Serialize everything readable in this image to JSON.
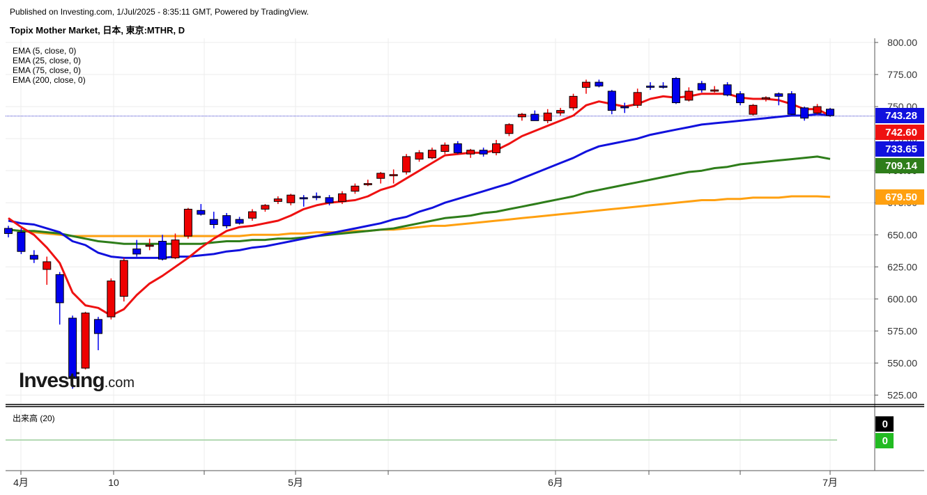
{
  "header": {
    "published": "Published on Investing.com, 1/Jul/2025 - 8:35:11 GMT, Powered by TradingView.",
    "title": "Topix Mother Market, 日本, 東京:MTHR, D"
  },
  "legend": {
    "ema5": "EMA (5, close, 0)",
    "ema25": "EMA (25, close, 0)",
    "ema75": "EMA (75, close, 0)",
    "ema200": "EMA (200, close, 0)"
  },
  "volume_label": "出来高 (20)",
  "logo": {
    "brand": "Investing",
    "suffix": ".com"
  },
  "colors": {
    "up": "#ee0000",
    "down": "#0000ee",
    "ema5": "#ee1111",
    "ema25": "#1111dd",
    "ema75": "#2e7d1a",
    "ema200": "#ffa010",
    "grid": "#ececec"
  },
  "chart_data": {
    "type": "candlestick",
    "ylim": [
      520,
      800
    ],
    "y_ticks": [
      "800.00",
      "775.00",
      "750.00",
      "725.00",
      "700.00",
      "675.00",
      "650.00",
      "625.00",
      "600.00",
      "575.00",
      "550.00",
      "525.00"
    ],
    "x_tick_labels": [
      "4月",
      "10",
      "5月",
      "6月",
      "7月"
    ],
    "last_price": 742.6,
    "price_tags": [
      {
        "label": "743.28",
        "value": 743.28,
        "color": "#1111dd"
      },
      {
        "label": "742.60",
        "value": 742.6,
        "color": "#ee1111"
      },
      {
        "label": "733.65",
        "value": 733.65,
        "color": "#1111dd"
      },
      {
        "label": "709.14",
        "value": 709.14,
        "color": "#2e7d1a"
      },
      {
        "label": "679.50",
        "value": 679.5,
        "color": "#ffa010"
      }
    ],
    "volume_tags": [
      {
        "label": "0",
        "color": "#000000"
      },
      {
        "label": "0",
        "color": "#22bb22"
      }
    ],
    "candles": [
      {
        "o": 655,
        "h": 657,
        "l": 648,
        "c": 651
      },
      {
        "o": 652,
        "h": 655,
        "l": 635,
        "c": 637
      },
      {
        "o": 634,
        "h": 638,
        "l": 628,
        "c": 631
      },
      {
        "o": 623,
        "h": 633,
        "l": 611,
        "c": 629
      },
      {
        "o": 619,
        "h": 621,
        "l": 580,
        "c": 597
      },
      {
        "o": 585,
        "h": 587,
        "l": 530,
        "c": 538
      },
      {
        "o": 546,
        "h": 590,
        "l": 545,
        "c": 589
      },
      {
        "o": 584,
        "h": 586,
        "l": 560,
        "c": 573
      },
      {
        "o": 586,
        "h": 616,
        "l": 584,
        "c": 614
      },
      {
        "o": 602,
        "h": 632,
        "l": 598,
        "c": 630
      },
      {
        "o": 639,
        "h": 646,
        "l": 633,
        "c": 635
      },
      {
        "o": 641,
        "h": 647,
        "l": 638,
        "c": 642
      },
      {
        "o": 645,
        "h": 650,
        "l": 630,
        "c": 631
      },
      {
        "o": 632,
        "h": 651,
        "l": 631,
        "c": 646
      },
      {
        "o": 649,
        "h": 671,
        "l": 647,
        "c": 670
      },
      {
        "o": 669,
        "h": 674,
        "l": 665,
        "c": 666
      },
      {
        "o": 662,
        "h": 668,
        "l": 655,
        "c": 658
      },
      {
        "o": 665,
        "h": 667,
        "l": 655,
        "c": 657
      },
      {
        "o": 662,
        "h": 664,
        "l": 658,
        "c": 659
      },
      {
        "o": 663,
        "h": 670,
        "l": 661,
        "c": 668
      },
      {
        "o": 670,
        "h": 674,
        "l": 668,
        "c": 673
      },
      {
        "o": 676,
        "h": 680,
        "l": 674,
        "c": 678
      },
      {
        "o": 675,
        "h": 682,
        "l": 673,
        "c": 681
      },
      {
        "o": 679,
        "h": 681,
        "l": 672,
        "c": 678
      },
      {
        "o": 680,
        "h": 683,
        "l": 677,
        "c": 679
      },
      {
        "o": 679,
        "h": 681,
        "l": 673,
        "c": 675
      },
      {
        "o": 676,
        "h": 684,
        "l": 674,
        "c": 682
      },
      {
        "o": 684,
        "h": 690,
        "l": 682,
        "c": 688
      },
      {
        "o": 689,
        "h": 693,
        "l": 688,
        "c": 690
      },
      {
        "o": 694,
        "h": 699,
        "l": 690,
        "c": 698
      },
      {
        "o": 696,
        "h": 701,
        "l": 690,
        "c": 697
      },
      {
        "o": 699,
        "h": 713,
        "l": 697,
        "c": 711
      },
      {
        "o": 709,
        "h": 716,
        "l": 707,
        "c": 714
      },
      {
        "o": 710,
        "h": 718,
        "l": 709,
        "c": 716
      },
      {
        "o": 715,
        "h": 722,
        "l": 713,
        "c": 720
      },
      {
        "o": 721,
        "h": 723,
        "l": 713,
        "c": 714
      },
      {
        "o": 713,
        "h": 717,
        "l": 710,
        "c": 716
      },
      {
        "o": 716,
        "h": 718,
        "l": 711,
        "c": 713
      },
      {
        "o": 714,
        "h": 724,
        "l": 712,
        "c": 721
      },
      {
        "o": 729,
        "h": 737,
        "l": 727,
        "c": 736
      },
      {
        "o": 742,
        "h": 745,
        "l": 739,
        "c": 744
      },
      {
        "o": 744,
        "h": 747,
        "l": 740,
        "c": 739
      },
      {
        "o": 739,
        "h": 748,
        "l": 737,
        "c": 745
      },
      {
        "o": 745,
        "h": 749,
        "l": 743,
        "c": 747
      },
      {
        "o": 749,
        "h": 760,
        "l": 747,
        "c": 758
      },
      {
        "o": 765,
        "h": 771,
        "l": 760,
        "c": 769
      },
      {
        "o": 769,
        "h": 771,
        "l": 765,
        "c": 766
      },
      {
        "o": 762,
        "h": 763,
        "l": 744,
        "c": 747
      },
      {
        "o": 750,
        "h": 753,
        "l": 745,
        "c": 749
      },
      {
        "o": 751,
        "h": 764,
        "l": 749,
        "c": 761
      },
      {
        "o": 766,
        "h": 769,
        "l": 763,
        "c": 765
      },
      {
        "o": 766,
        "h": 769,
        "l": 764,
        "c": 765
      },
      {
        "o": 772,
        "h": 773,
        "l": 752,
        "c": 753
      },
      {
        "o": 755,
        "h": 765,
        "l": 754,
        "c": 762
      },
      {
        "o": 768,
        "h": 770,
        "l": 761,
        "c": 763
      },
      {
        "o": 762,
        "h": 766,
        "l": 761,
        "c": 763
      },
      {
        "o": 767,
        "h": 769,
        "l": 758,
        "c": 759
      },
      {
        "o": 760,
        "h": 762,
        "l": 751,
        "c": 753
      },
      {
        "o": 744,
        "h": 752,
        "l": 743,
        "c": 751
      },
      {
        "o": 756,
        "h": 758,
        "l": 754,
        "c": 757
      },
      {
        "o": 760,
        "h": 761,
        "l": 751,
        "c": 758
      },
      {
        "o": 760,
        "h": 762,
        "l": 743,
        "c": 744
      },
      {
        "o": 749,
        "h": 750,
        "l": 739,
        "c": 741
      },
      {
        "o": 745,
        "h": 752,
        "l": 744,
        "c": 750
      },
      {
        "o": 748,
        "h": 749,
        "l": 742,
        "c": 743
      }
    ],
    "series": [
      {
        "name": "EMA (5, close, 0)",
        "values": [
          663,
          656,
          650,
          640,
          628,
          605,
          595,
          593,
          587,
          592,
          603,
          612,
          618,
          625,
          632,
          640,
          647,
          653,
          656,
          657,
          659,
          661,
          665,
          670,
          673,
          675,
          676,
          677,
          680,
          685,
          688,
          694,
          700,
          706,
          712,
          713,
          714,
          714,
          716,
          721,
          727,
          731,
          735,
          739,
          743,
          751,
          754,
          752,
          750,
          752,
          756,
          758,
          757,
          758,
          760,
          760,
          760,
          757,
          756,
          756,
          755,
          752,
          748,
          748,
          743
        ]
      },
      {
        "name": "EMA (25, close, 0)",
        "values": [
          661,
          659,
          658,
          655,
          652,
          645,
          642,
          636,
          633,
          632,
          632,
          632,
          632,
          633,
          633,
          634,
          635,
          637,
          638,
          640,
          641,
          643,
          645,
          647,
          649,
          651,
          653,
          655,
          657,
          659,
          662,
          664,
          668,
          671,
          675,
          678,
          681,
          684,
          687,
          690,
          694,
          698,
          702,
          706,
          710,
          715,
          719,
          721,
          723,
          725,
          728,
          730,
          732,
          734,
          736,
          737,
          738,
          739,
          740,
          741,
          742,
          743,
          743,
          744,
          743.28
        ]
      },
      {
        "name": "EMA (75, close, 0)",
        "values": [
          654,
          653,
          653,
          652,
          651,
          649,
          647,
          645,
          644,
          643,
          643,
          643,
          643,
          643,
          643,
          643,
          644,
          645,
          645,
          646,
          646,
          647,
          647,
          648,
          649,
          650,
          651,
          652,
          653,
          654,
          655,
          657,
          659,
          661,
          663,
          664,
          665,
          667,
          668,
          670,
          672,
          674,
          676,
          678,
          680,
          683,
          685,
          687,
          689,
          691,
          693,
          695,
          697,
          699,
          700,
          702,
          703,
          705,
          706,
          707,
          708,
          709,
          710,
          711,
          709.14
        ]
      },
      {
        "name": "EMA (200, close, 0)",
        "values": [
          654,
          653,
          652,
          651,
          650,
          649,
          649,
          649,
          649,
          649,
          649,
          649,
          649,
          649,
          649,
          649,
          649,
          649,
          649,
          650,
          650,
          650,
          651,
          651,
          652,
          652,
          652,
          653,
          653,
          654,
          654,
          655,
          656,
          657,
          657,
          658,
          659,
          660,
          661,
          662,
          663,
          664,
          665,
          666,
          667,
          668,
          669,
          670,
          671,
          672,
          673,
          674,
          675,
          676,
          677,
          677,
          678,
          678,
          679,
          679,
          679,
          680,
          680,
          680,
          679.5
        ]
      }
    ]
  }
}
